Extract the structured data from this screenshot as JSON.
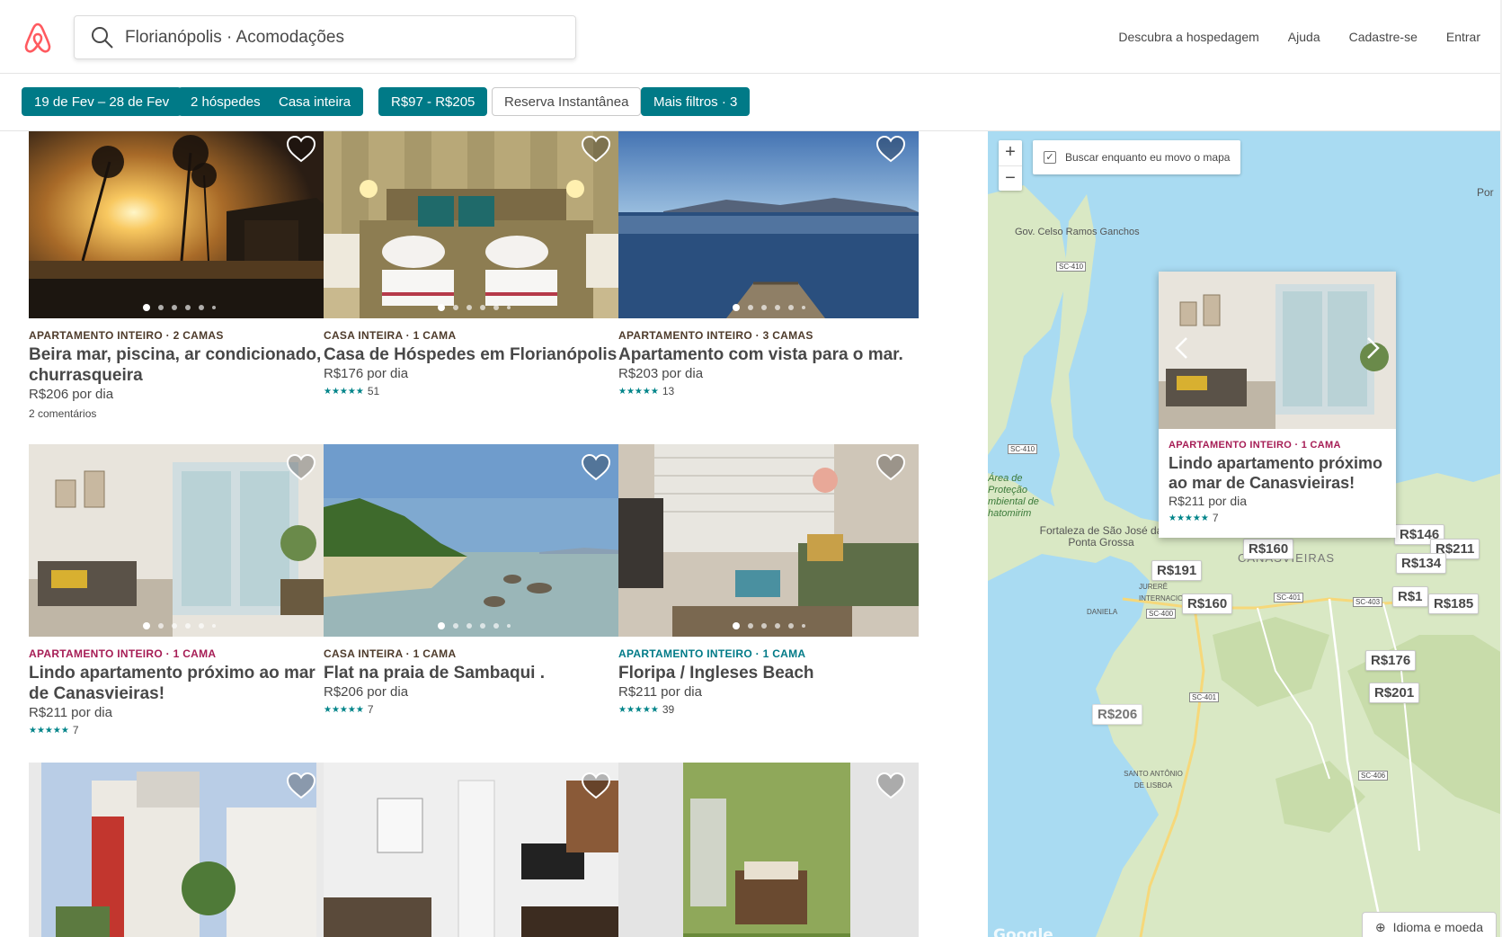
{
  "header": {
    "search_value": "Florianópolis · Acomodações",
    "nav": [
      "Descubra a hospedagem",
      "Ajuda",
      "Cadastre-se",
      "Entrar"
    ]
  },
  "filters": [
    {
      "label": "19 de Fev – 28 de Fev",
      "active": true
    },
    {
      "label": "2 hóspedes",
      "active": true
    },
    {
      "label": "Casa inteira",
      "active": true
    },
    {
      "label": "R$97 - R$205",
      "active": true
    },
    {
      "label": "Reserva Instantânea",
      "active": false
    },
    {
      "label": "Mais filtros · 3",
      "active": true
    }
  ],
  "listings": [
    {
      "kicker": "APARTAMENTO INTEIRO · 2 CAMAS",
      "kicker_color": "dark",
      "title": "Beira mar, piscina, ar condicionado, churrasqueira",
      "price": "R$206",
      "per": "por dia",
      "note": "2 comentários",
      "stars": "",
      "reviews": "",
      "scene": "sunset"
    },
    {
      "kicker": "CASA INTEIRA · 1 CAMA",
      "kicker_color": "dark",
      "title": "Casa de Hóspedes em Florianópolis",
      "price": "R$176",
      "per": "por dia",
      "note": "",
      "stars": "★★★★★",
      "reviews": "51",
      "scene": "bedroom"
    },
    {
      "kicker": "APARTAMENTO INTEIRO · 3 CAMAS",
      "kicker_color": "dark",
      "title": "Apartamento com vista para o mar.",
      "price": "R$203",
      "per": "por dia",
      "note": "",
      "stars": "★★★★★",
      "reviews": "13",
      "scene": "pier"
    },
    {
      "kicker": "APARTAMENTO INTEIRO · 1 CAMA",
      "kicker_color": "red",
      "title": "Lindo apartamento próximo ao mar de Canasvieiras!",
      "price": "R$211",
      "per": "por dia",
      "note": "",
      "stars": "★★★★★",
      "reviews": "7",
      "scene": "living"
    },
    {
      "kicker": "CASA INTEIRA · 1 CAMA",
      "kicker_color": "dark",
      "title": "Flat na praia de Sambaqui .",
      "price": "R$206",
      "per": "por dia",
      "note": "",
      "stars": "★★★★★",
      "reviews": "7",
      "scene": "beach"
    },
    {
      "kicker": "APARTAMENTO INTEIRO · 1 CAMA",
      "kicker_color": "teal",
      "title": "Floripa / Ingleses Beach",
      "price": "R$211",
      "per": "por dia",
      "note": "",
      "stars": "★★★★★",
      "reviews": "39",
      "scene": "sofa"
    },
    {
      "kicker": "",
      "kicker_color": "dark",
      "title": "",
      "price": "",
      "per": "",
      "note": "",
      "stars": "",
      "reviews": "",
      "scene": "building"
    },
    {
      "kicker": "",
      "kicker_color": "dark",
      "title": "",
      "price": "",
      "per": "",
      "note": "",
      "stars": "",
      "reviews": "",
      "scene": "interior"
    },
    {
      "kicker": "",
      "kicker_color": "dark",
      "title": "",
      "price": "",
      "per": "",
      "note": "",
      "stars": "",
      "reviews": "",
      "scene": "green"
    }
  ],
  "map": {
    "search_as_move": "Buscar enquanto eu movo o mapa",
    "zoom_in": "+",
    "zoom_out": "−",
    "popup": {
      "kicker": "APARTAMENTO INTEIRO · 1 CAMA",
      "title": "Lindo apartamento próximo ao mar de Canasvieiras!",
      "price": "R$211",
      "per": "por dia",
      "stars": "★★★★★",
      "reviews": "7"
    },
    "pins": [
      "R$146",
      "R$211",
      "R$160",
      "R$134",
      "R$191",
      "R$160",
      "R$1",
      "R$185",
      "R$176",
      "R$201",
      "R$206"
    ],
    "places": {
      "gov": "Gov. Celso Ramos Ganchos",
      "area": "Área de Proteção mbiental de hatomirim",
      "fortaleza": "Fortaleza de São José da Ponta Grossa",
      "canasvieiras": "CANASVIEIRAS",
      "jurere": "JURERÊ INTERNACIONAL",
      "daniela": "DANIELA",
      "santo": "SANTO ANTÔNIO DE LISBOA",
      "por": "Por"
    },
    "roads": [
      "SC-410",
      "SC-410",
      "SC-401",
      "SC-403",
      "SC-400",
      "SC-401",
      "SC-406"
    ],
    "language": "Idioma e moeda",
    "google": "Google"
  }
}
